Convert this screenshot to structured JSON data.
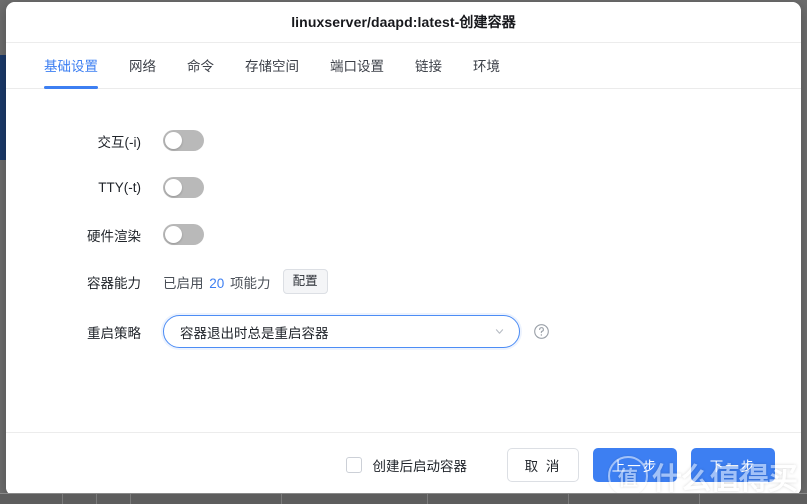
{
  "dialog": {
    "title": "linuxserver/daapd:latest-创建容器"
  },
  "tabs": [
    {
      "label": "基础设置",
      "active": true
    },
    {
      "label": "网络",
      "active": false
    },
    {
      "label": "命令",
      "active": false
    },
    {
      "label": "存储空间",
      "active": false
    },
    {
      "label": "端口设置",
      "active": false
    },
    {
      "label": "链接",
      "active": false
    },
    {
      "label": "环境",
      "active": false
    }
  ],
  "form": {
    "interactive": {
      "label": "交互(-i)",
      "state": "off"
    },
    "tty": {
      "label": "TTY(-t)",
      "state": "off"
    },
    "hardware_render": {
      "label": "硬件渲染",
      "state": "off"
    },
    "capabilities": {
      "label": "容器能力",
      "text_prefix": "已启用",
      "count": "20",
      "text_suffix": "项能力",
      "button_label": "配置"
    },
    "restart_policy": {
      "label": "重启策略",
      "value": "容器退出时总是重启容器",
      "help_icon": "question-circle-icon",
      "chevron_icon": "chevron-down-icon"
    }
  },
  "footer": {
    "start_after_create": {
      "label": "创建后启动容器",
      "checked": false
    },
    "cancel_label": "取 消",
    "previous_label": "上一步",
    "next_label": "下一步"
  },
  "watermark": {
    "logo_char": "值",
    "text": "什么值得买"
  },
  "colors": {
    "accent": "#3d7ff2",
    "switch_off": "#b9b9b9",
    "border": "#dcdfe4",
    "backdrop": "#6e6e6e",
    "sidebar_strip": "#1b3a6b"
  }
}
